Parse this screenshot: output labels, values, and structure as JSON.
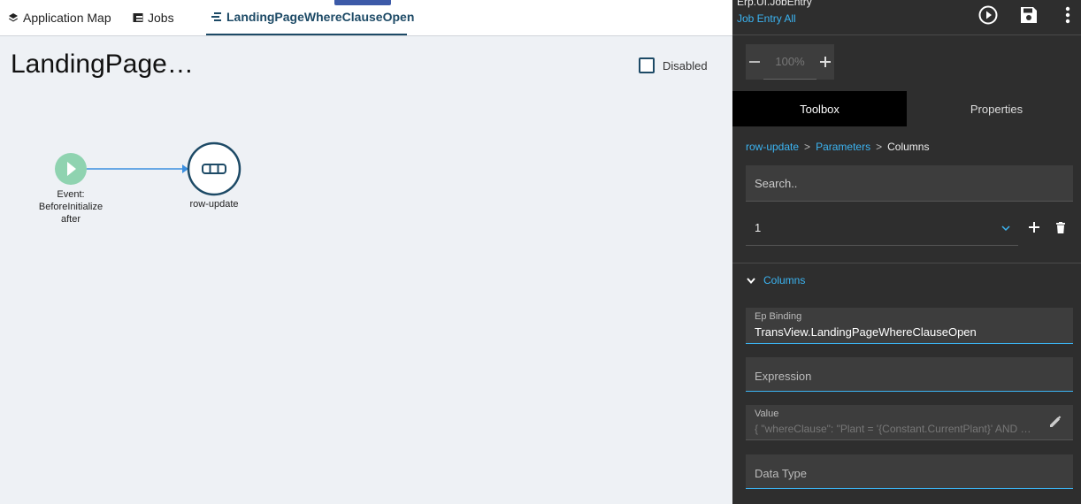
{
  "tabs": {
    "app_map": "Application Map",
    "jobs": "Jobs",
    "landing": "LandingPageWhereClauseOpen"
  },
  "page": {
    "title": "LandingPage…",
    "disabled_label": "Disabled"
  },
  "flow": {
    "event_node_label_1": "Event:",
    "event_node_label_2": "BeforeInitialize",
    "event_node_label_3": "after",
    "action_node_label": "row-update",
    "colors": {
      "event_node": "#8fd3b0",
      "action_node_border": "#1d4a66",
      "connector": "#3b8fe0"
    }
  },
  "header": {
    "app_name": "Erp.UI.JobEntry",
    "job_entry_link": "Job Entry All"
  },
  "zoom": {
    "value": "100%"
  },
  "panel_tabs": {
    "toolbox": "Toolbox",
    "properties": "Properties"
  },
  "breadcrumb": {
    "item1": "row-update",
    "item2": "Parameters",
    "current": "Columns",
    "separator": ">"
  },
  "search": {
    "placeholder": "Search.."
  },
  "selector": {
    "value": "1"
  },
  "section": {
    "title": "Columns"
  },
  "fields": {
    "ep_binding_label": "Ep Binding",
    "ep_binding_value": "TransView.LandingPageWhereClauseOpen",
    "expression_placeholder": "Expression",
    "value_label": "Value",
    "value_value": "{  \"whereClause\": \"Plant = '{Constant.CurrentPlant}' AND JobClosed = false\" }",
    "data_type_placeholder": "Data Type"
  },
  "accent_colors": {
    "link": "#3bb4f2",
    "tab_active": "#1d4a66",
    "panel_bg": "#2e2e2e"
  }
}
